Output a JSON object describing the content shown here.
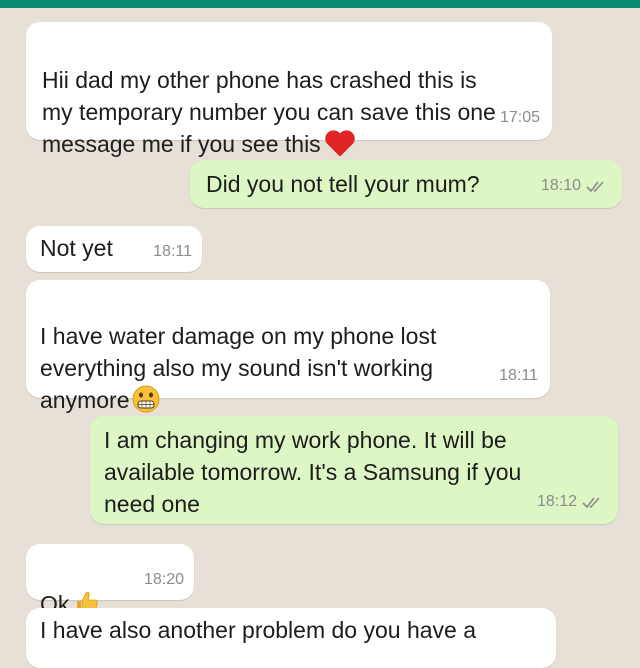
{
  "colors": {
    "accent": "#0b8a72",
    "chat_background": "#e7e0d7",
    "incoming_bubble": "#ffffff",
    "outgoing_bubble": "#dcf6c4"
  },
  "messages": [
    {
      "direction": "incoming",
      "text": "Hii dad my other phone has crashed this is\nmy temporary number you can save this one\nmessage me if you see this",
      "emoji": "red-heart-icon",
      "time": "17:05"
    },
    {
      "direction": "outgoing",
      "text": "Did you not tell your mum?",
      "time": "18:10",
      "status": "delivered-double-check-icon"
    },
    {
      "direction": "incoming",
      "text": "Not yet",
      "time": "18:11"
    },
    {
      "direction": "incoming",
      "text": "I have water damage on my phone lost\neverything also my sound isn't working\nanymore",
      "emoji": "grimacing-face-icon",
      "time": "18:11"
    },
    {
      "direction": "outgoing",
      "text": "I am changing my work phone. It will be\navailable tomorrow. It's a Samsung if you\nneed one",
      "time": "18:12",
      "status": "delivered-double-check-icon"
    },
    {
      "direction": "incoming",
      "text": "Ok",
      "emoji": "thumbs-up-icon",
      "time": "18:20"
    },
    {
      "direction": "incoming",
      "text": "I have also another problem do you have a",
      "time": ""
    }
  ]
}
